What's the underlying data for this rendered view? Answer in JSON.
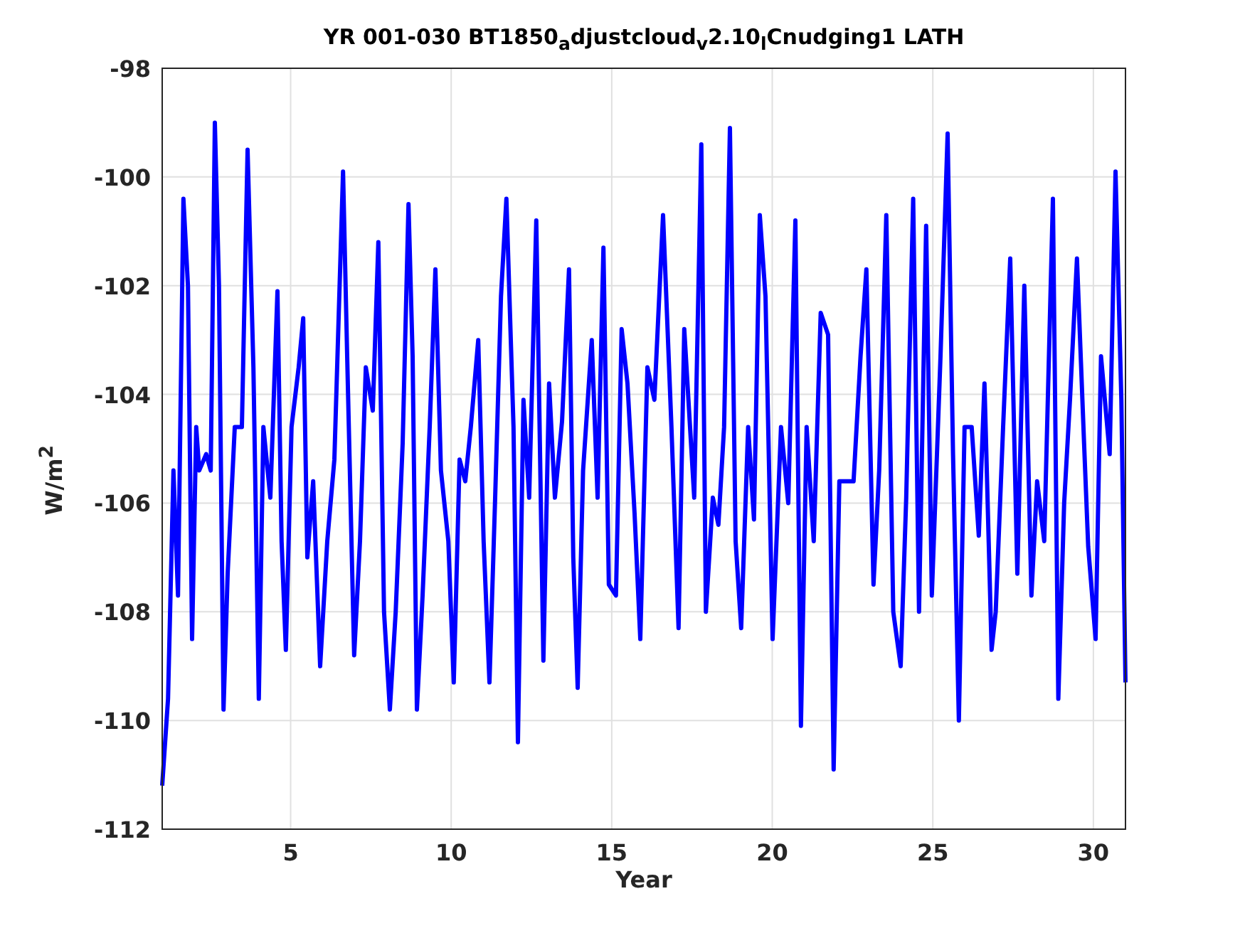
{
  "figure": {
    "chart_data": {
      "type": "line",
      "title": "YR 001-030 BT1850$_{a}$djustcloud$_{v}$2.10$_{l}$Cnudging1 LATH",
      "xlabel": "Year",
      "ylabel": "W/m$^{2}$",
      "grid": true,
      "xlim": [
        1,
        31
      ],
      "ylim": [
        -112,
        -98
      ],
      "xticks": [
        5,
        10,
        15,
        20,
        25,
        30
      ],
      "yticks": [
        -112,
        -110,
        -108,
        -106,
        -104,
        -102,
        -100,
        -98
      ],
      "x": [
        1.0,
        1.18,
        1.35,
        1.49,
        1.66,
        1.8,
        1.93,
        2.06,
        2.15,
        2.37,
        2.51,
        2.64,
        2.77,
        2.91,
        3.04,
        3.26,
        3.48,
        3.66,
        3.84,
        4.01,
        4.15,
        4.37,
        4.59,
        4.72,
        4.85,
        5.03,
        5.25,
        5.39,
        5.52,
        5.7,
        5.92,
        6.14,
        6.36,
        6.63,
        6.76,
        6.98,
        7.16,
        7.34,
        7.56,
        7.73,
        7.91,
        8.09,
        8.27,
        8.49,
        8.67,
        8.8,
        8.93,
        9.11,
        9.33,
        9.51,
        9.68,
        9.91,
        10.08,
        10.26,
        10.44,
        10.61,
        10.84,
        11.01,
        11.19,
        11.37,
        11.55,
        11.72,
        11.94,
        12.08,
        12.25,
        12.43,
        12.65,
        12.87,
        13.05,
        13.23,
        13.45,
        13.67,
        13.8,
        13.94,
        14.11,
        14.38,
        14.56,
        14.74,
        14.91,
        15.13,
        15.31,
        15.49,
        15.71,
        15.89,
        16.11,
        16.33,
        16.6,
        16.86,
        17.08,
        17.26,
        17.57,
        17.79,
        17.93,
        18.15,
        18.32,
        18.5,
        18.68,
        18.86,
        19.03,
        19.25,
        19.43,
        19.61,
        19.79,
        20.01,
        20.27,
        20.5,
        20.72,
        20.89,
        21.07,
        21.29,
        21.51,
        21.74,
        21.91,
        22.09,
        22.31,
        22.53,
        22.75,
        22.93,
        23.15,
        23.33,
        23.55,
        23.77,
        24.0,
        24.17,
        24.39,
        24.57,
        24.79,
        24.97,
        25.24,
        25.46,
        25.63,
        25.81,
        25.99,
        26.21,
        26.43,
        26.61,
        26.83,
        26.96,
        27.19,
        27.41,
        27.63,
        27.85,
        28.07,
        28.25,
        28.47,
        28.74,
        28.91,
        29.09,
        29.27,
        29.49,
        29.71,
        29.84,
        30.07,
        30.24,
        30.51,
        30.69,
        30.87,
        31.0
      ],
      "series": [
        {
          "color": "#0000ff",
          "values": [
            -111.2,
            -109.6,
            -105.4,
            -107.7,
            -100.4,
            -102.0,
            -108.5,
            -104.6,
            -105.4,
            -105.1,
            -105.4,
            -99.0,
            -102.0,
            -109.8,
            -107.3,
            -104.6,
            -104.6,
            -99.5,
            -103.5,
            -109.6,
            -104.6,
            -105.9,
            -102.1,
            -106.7,
            -108.7,
            -104.6,
            -103.5,
            -102.6,
            -107.0,
            -105.6,
            -109.0,
            -106.7,
            -105.2,
            -99.9,
            -103.3,
            -108.8,
            -106.7,
            -103.5,
            -104.3,
            -101.2,
            -108.0,
            -109.8,
            -108.0,
            -104.9,
            -100.5,
            -103.3,
            -109.8,
            -107.7,
            -104.6,
            -101.7,
            -105.4,
            -106.7,
            -109.3,
            -105.2,
            -105.6,
            -104.6,
            -103.0,
            -106.7,
            -109.3,
            -105.9,
            -102.2,
            -100.4,
            -104.6,
            -110.4,
            -104.1,
            -105.9,
            -100.8,
            -108.9,
            -103.8,
            -105.9,
            -104.5,
            -101.7,
            -107.0,
            -109.4,
            -105.4,
            -103.0,
            -105.9,
            -101.3,
            -107.5,
            -107.7,
            -102.8,
            -103.8,
            -106.2,
            -108.5,
            -103.5,
            -104.1,
            -100.7,
            -104.6,
            -108.3,
            -102.8,
            -105.9,
            -99.4,
            -108.0,
            -105.9,
            -106.4,
            -104.6,
            -99.1,
            -106.7,
            -108.3,
            -104.6,
            -106.3,
            -100.7,
            -102.2,
            -108.5,
            -104.6,
            -106.0,
            -100.8,
            -110.1,
            -104.6,
            -106.7,
            -102.5,
            -102.9,
            -110.9,
            -105.6,
            -105.6,
            -105.6,
            -103.3,
            -101.7,
            -107.5,
            -105.4,
            -100.7,
            -108.0,
            -109.0,
            -105.9,
            -100.4,
            -108.0,
            -100.9,
            -107.7,
            -103.3,
            -99.2,
            -105.1,
            -110.0,
            -104.6,
            -104.6,
            -106.6,
            -103.8,
            -108.7,
            -108.0,
            -104.6,
            -101.5,
            -107.3,
            -102.0,
            -107.7,
            -105.6,
            -106.7,
            -100.4,
            -109.6,
            -106.0,
            -104.1,
            -101.5,
            -104.9,
            -106.8,
            -108.5,
            -103.3,
            -105.1,
            -99.9,
            -104.1,
            -109.3
          ]
        }
      ]
    }
  }
}
